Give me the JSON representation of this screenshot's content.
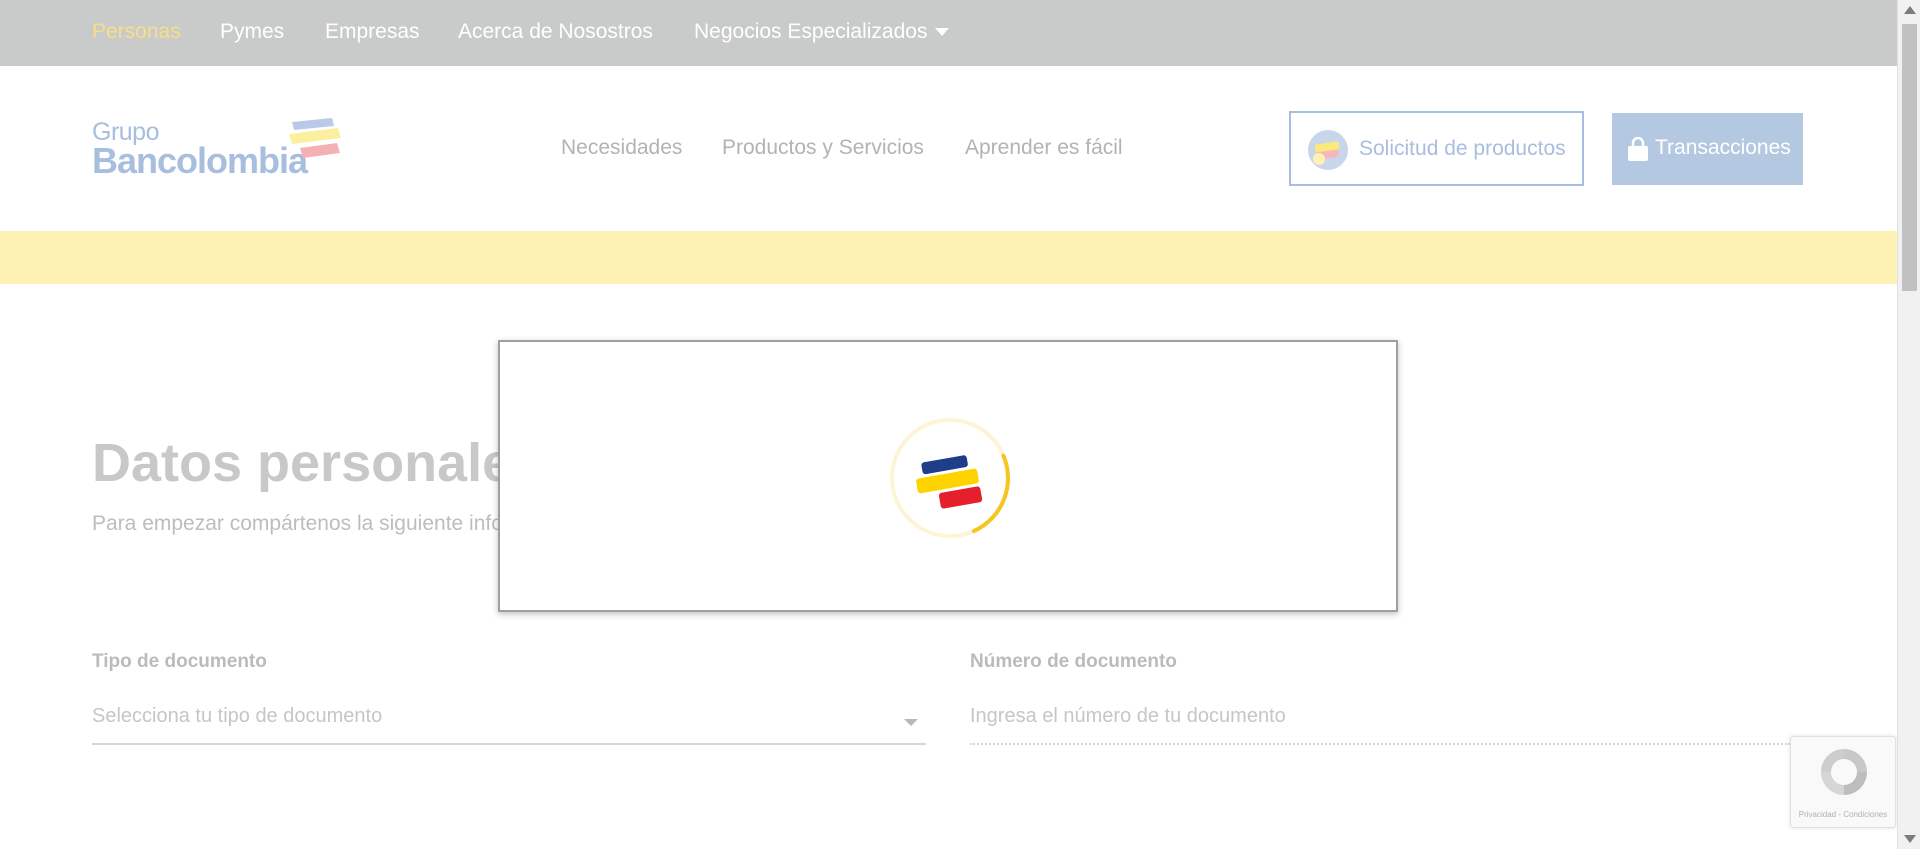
{
  "topbar": {
    "items": [
      {
        "label": "Personas",
        "active": true
      },
      {
        "label": "Pymes",
        "active": false
      },
      {
        "label": "Empresas",
        "active": false
      },
      {
        "label": "Acerca de Nosostros",
        "active": false
      },
      {
        "label": "Negocios Especializados",
        "active": false
      }
    ],
    "dropdown_icon": "chevron-down-icon"
  },
  "header": {
    "logo": {
      "line1": "Grupo",
      "line2": "Bancolombia"
    },
    "nav": [
      {
        "label": "Necesidades"
      },
      {
        "label": "Productos y Servicios"
      },
      {
        "label": "Aprender es fácil"
      }
    ],
    "solicitud_button": {
      "label": "Solicitud de productos",
      "icon": "products-icon"
    },
    "transacciones_button": {
      "label": "Transacciones",
      "icon": "lock-icon"
    }
  },
  "form": {
    "title": "Datos personales",
    "subtitle": "Para empezar compártenos la siguiente información",
    "document_type": {
      "label": "Tipo de documento",
      "placeholder": "Selecciona tu tipo de documento"
    },
    "document_number": {
      "label": "Número de documento",
      "placeholder": "Ingresa el número de tu documento"
    }
  },
  "modal": {
    "loader_icon": "bancolombia-loading-spinner-icon"
  },
  "recaptcha": {
    "links": "Privacidad - Condiciones"
  },
  "colors": {
    "topbar": "#c9caca",
    "active_nav": "#f8dd8c",
    "banner": "#fdf1b3",
    "primary_button": "#b4c8e1",
    "brand_blue": "#1f3e8a",
    "brand_yellow": "#fdd300",
    "brand_red": "#e5202c"
  }
}
